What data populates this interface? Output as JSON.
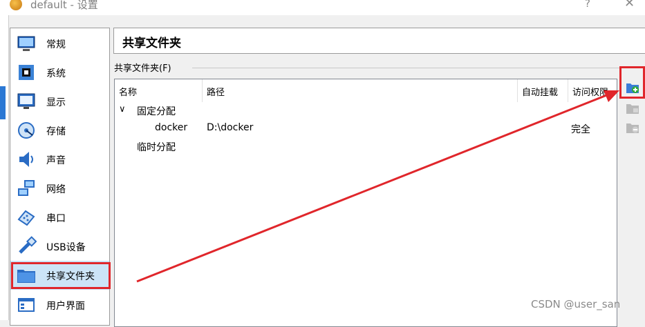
{
  "window": {
    "title": "default - 设置",
    "help_label": "?",
    "close_label": "✕"
  },
  "sidebar": {
    "items": [
      {
        "label": "常规",
        "icon": "monitor-icon"
      },
      {
        "label": "系统",
        "icon": "chip-icon"
      },
      {
        "label": "显示",
        "icon": "display-icon"
      },
      {
        "label": "存储",
        "icon": "disk-icon"
      },
      {
        "label": "声音",
        "icon": "speaker-icon"
      },
      {
        "label": "网络",
        "icon": "network-icon"
      },
      {
        "label": "串口",
        "icon": "serial-port-icon"
      },
      {
        "label": "USB设备",
        "icon": "usb-icon"
      },
      {
        "label": "共享文件夹",
        "icon": "folder-icon",
        "selected": true
      },
      {
        "label": "用户界面",
        "icon": "window-icon"
      }
    ]
  },
  "header": {
    "title": "共享文件夹"
  },
  "shared_folders": {
    "group_label": "共享文件夹(F)",
    "columns": [
      "名称",
      "路径",
      "自动挂载",
      "访问权限"
    ],
    "groups": [
      {
        "label": "固定分配",
        "expanded": true,
        "rows": [
          {
            "name": "docker",
            "path": "D:\\docker",
            "auto_mount": "",
            "access": "完全"
          }
        ]
      },
      {
        "label": "临时分配",
        "rows": []
      }
    ],
    "expand_glyph": "∨"
  },
  "toolbar": {
    "buttons": [
      {
        "icon": "add-folder-icon",
        "enabled": true
      },
      {
        "icon": "edit-folder-icon",
        "enabled": false
      },
      {
        "icon": "remove-folder-icon",
        "enabled": false
      }
    ]
  },
  "annotation": {
    "color": "#e0262b"
  },
  "watermark": "CSDN @user_san"
}
